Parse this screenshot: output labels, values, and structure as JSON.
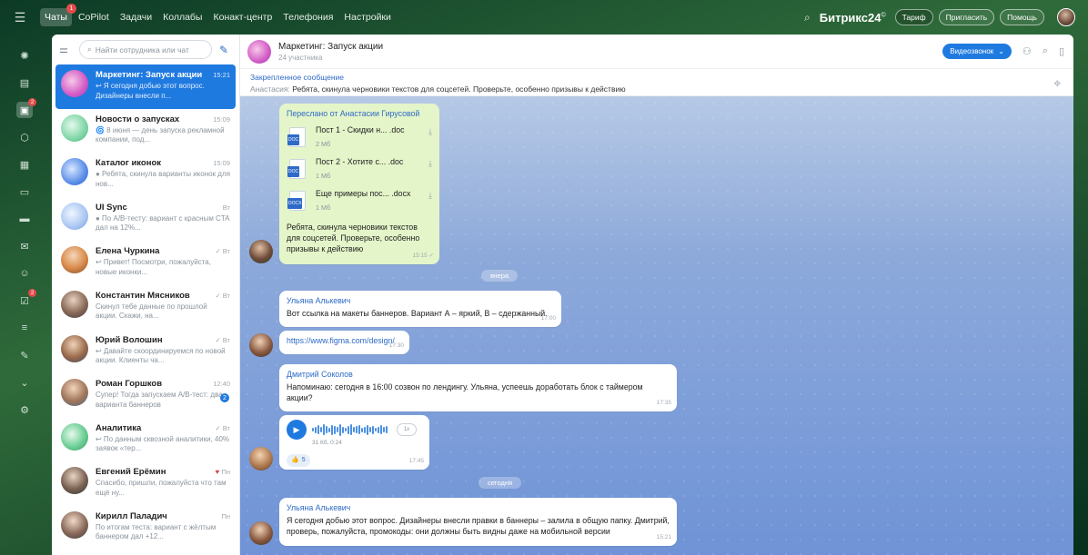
{
  "topbar": {
    "nav": [
      {
        "label": "Чаты",
        "badge": "1",
        "active": true
      },
      {
        "label": "CoPilot"
      },
      {
        "label": "Задачи"
      },
      {
        "label": "Коллабы"
      },
      {
        "label": "Конакт-центр"
      },
      {
        "label": "Телефония"
      },
      {
        "label": "Настройки"
      }
    ],
    "brand": "Битрикс24",
    "brand_mark": "©",
    "tariff": "Тариф",
    "invite": "Пригласить",
    "help": "Помощь"
  },
  "rail": {
    "icons": [
      {
        "name": "copilot-icon",
        "glyph": "✺"
      },
      {
        "name": "tasks-icon",
        "glyph": "▤"
      },
      {
        "name": "chats-icon",
        "glyph": "▣",
        "active": true,
        "badge": "2"
      },
      {
        "name": "collabs-icon",
        "glyph": "⬡"
      },
      {
        "name": "calendar-icon",
        "glyph": "▦"
      },
      {
        "name": "docs-icon",
        "glyph": "▭"
      },
      {
        "name": "drive-icon",
        "glyph": "▬"
      },
      {
        "name": "mail-icon",
        "glyph": "✉"
      },
      {
        "name": "contacts-icon",
        "glyph": "☺"
      },
      {
        "name": "checklist-icon",
        "glyph": "☑",
        "badge": "2"
      },
      {
        "name": "filter-icon",
        "glyph": "≡"
      },
      {
        "name": "sign-icon",
        "glyph": "✎"
      },
      {
        "name": "more-icon",
        "glyph": "⌄"
      },
      {
        "name": "settings-icon",
        "glyph": "⚙"
      }
    ]
  },
  "chatlist": {
    "search_placeholder": "Найти сотрудника или чат",
    "items": [
      {
        "name": "Маркетинг: Запуск акции",
        "time": "15:21",
        "preview": "↩ Я сегодня добью этот вопрос. Дизайнеры внесли п...",
        "active": true,
        "avatar": "pink"
      },
      {
        "name": "Новости о запусках",
        "time": "15:09",
        "preview": "🌀 8 июня — день запуска рекламной компании, под...",
        "avatar": "mint"
      },
      {
        "name": "Каталог иконок",
        "time": "15:09",
        "preview": "● Ребята, скинула варианты иконок для нов...",
        "avatar": "blue"
      },
      {
        "name": "UI Sync",
        "time": "Вт",
        "preview": "● По A/B-тесту: вариант с красным CTA дал на 12%...",
        "avatar": "lightblue"
      },
      {
        "name": "Елена Чуркина",
        "time": "✓ Вт",
        "preview": "↩ Привет! Посмотри, пожалуйста, новые иконки...",
        "avatar": "p1"
      },
      {
        "name": "Константин Мясников",
        "time": "✓ Вт",
        "preview": "Скинул тебе данные по прошлой акции. Скажи, на...",
        "avatar": "p2"
      },
      {
        "name": "Юрий Волошин",
        "time": "✓ Вт",
        "preview": "↩ Давайте скоординируемся по новой акции. Клиенты ча...",
        "avatar": "p3"
      },
      {
        "name": "Роман Горшков",
        "time": "12:40",
        "preview": "Супер! Тогда запускаем A/B-тест: два варианта баннеров",
        "unread": "2",
        "avatar": "p4"
      },
      {
        "name": "Аналитика",
        "time": "✓ Вт",
        "preview": "↩ По данным сквозной аналитики, 40% заявок «тер...",
        "avatar": "green"
      },
      {
        "name": "Евгений Ерёмин",
        "time": "Пн",
        "heart": true,
        "preview": "Спасибо, пришли, пожалуйста что там ещё ну...",
        "avatar": "p5"
      },
      {
        "name": "Кирилл Паладич",
        "time": "Пн",
        "preview": "По итогам теста: вариант с жёлтым баннером дал +12...",
        "avatar": "p6"
      }
    ]
  },
  "chat": {
    "title": "Маркетинг: Запуск акции",
    "participants": "24 участника",
    "video_call": "Видеозвонок",
    "pinned_label": "Закрепленное сообщение",
    "pinned_author": "Анастасия:",
    "pinned_text": "Ребята, скинула черновики текстов для соцсетей. Проверьте, особенно призывы к действию",
    "forwarded_from": "Переслано от Анастасии Гирусовой",
    "files": [
      {
        "name": "Пост 1 - Скидки н... .doc",
        "size": "2 Мб",
        "ext": "DOC"
      },
      {
        "name": "Пост 2 - Хотите с... .doc",
        "size": "1 Мб",
        "ext": "DOC"
      },
      {
        "name": "Еще примеры пос... .docx",
        "size": "1 Мб",
        "ext": "DOCX"
      }
    ],
    "forward_text": "Ребята, скинула черновики текстов для соцсетей. Проверьте, особенно призывы к действию",
    "forward_time": "15:15",
    "date_yesterday": "вчера",
    "msg1_author": "Ульяна Алькевич",
    "msg1_text": "Вот ссылка на макеты баннеров. Вариант А – яркий, В – сдержанный.",
    "msg1_time": "17:00",
    "msg2_link": "https://www.figma.com/design/",
    "msg2_time": "17:30",
    "msg3_author": "Дмитрий Соколов",
    "msg3_text": "Напоминаю: сегодня в 16:00 созвон по лендингу. Ульяна, успеешь доработать блок с таймером акции?",
    "msg3_time": "17:35",
    "audio_meta": "31 Кб, 0:24",
    "audio_speed": "1x",
    "reaction_count": "5",
    "msg4_time": "17:45",
    "date_today": "сегодня",
    "msg5_author": "Ульяна Алькевич",
    "msg5_text": "Я сегодня добью этот вопрос. Дизайнеры внесли правки в баннеры – залила в общую папку. Дмитрий, проверь, пожалуйста, промокоды: они должны быть видны даже на мобильной версии",
    "msg5_time": "15:21"
  },
  "colors": {
    "accent": "#1f7ae0",
    "forward_bubble": "#e4f5c9",
    "link": "#2f6ac7"
  }
}
